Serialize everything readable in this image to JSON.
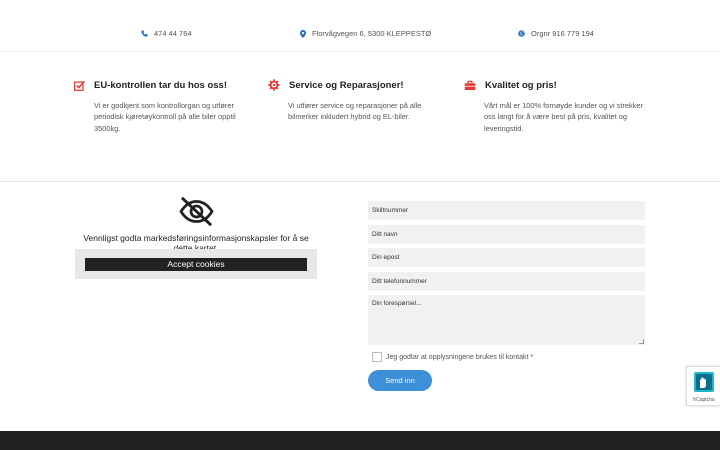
{
  "topbar": {
    "phone": "474 44 764",
    "address": "Florvågvegen 6, 5300 KLEPPESTØ",
    "org": "Orgnr 916 779 194"
  },
  "features": [
    {
      "title": "EU-kontrollen tar du hos oss!",
      "icon": "checkbox-check-icon",
      "description": "Vi er godkjent som kontrollorgan og utfører periodisk kjøretøykontroll på alle biler opptil 3500kg."
    },
    {
      "title": "Service og Reparasjoner!",
      "icon": "gear-wrench-icon",
      "description": "Vi utfører service og reparasjoner på alle bilmerker inkludert hybrid og EL-biler."
    },
    {
      "title": "Kvalitet og pris!",
      "icon": "toolbox-icon",
      "description": "Vårt mål er 100% fornøyde kunder og vi strekker oss langt for å være best på pris, kvalitet og leveringstid."
    }
  ],
  "map": {
    "notice": "Vennligst godta markedsføringsinformasjonskapsler for å se dette kartet.",
    "accept_label": "Accept cookies"
  },
  "form": {
    "reg_placeholder": "Skiltnummer",
    "name_placeholder": "Ditt navn",
    "email_placeholder": "Din epost",
    "phone_placeholder": "Ditt telefonnummer",
    "message_placeholder": "Din forespørsel...",
    "consent_label": "Jeg godtar at opplysningene brukes til kontakt *",
    "submit_label": "Send inn"
  },
  "captcha": {
    "label": "hCaptcha"
  },
  "colors": {
    "accent_red": "#e53935",
    "accent_blue": "#3d8fd8",
    "footer": "#222222"
  }
}
